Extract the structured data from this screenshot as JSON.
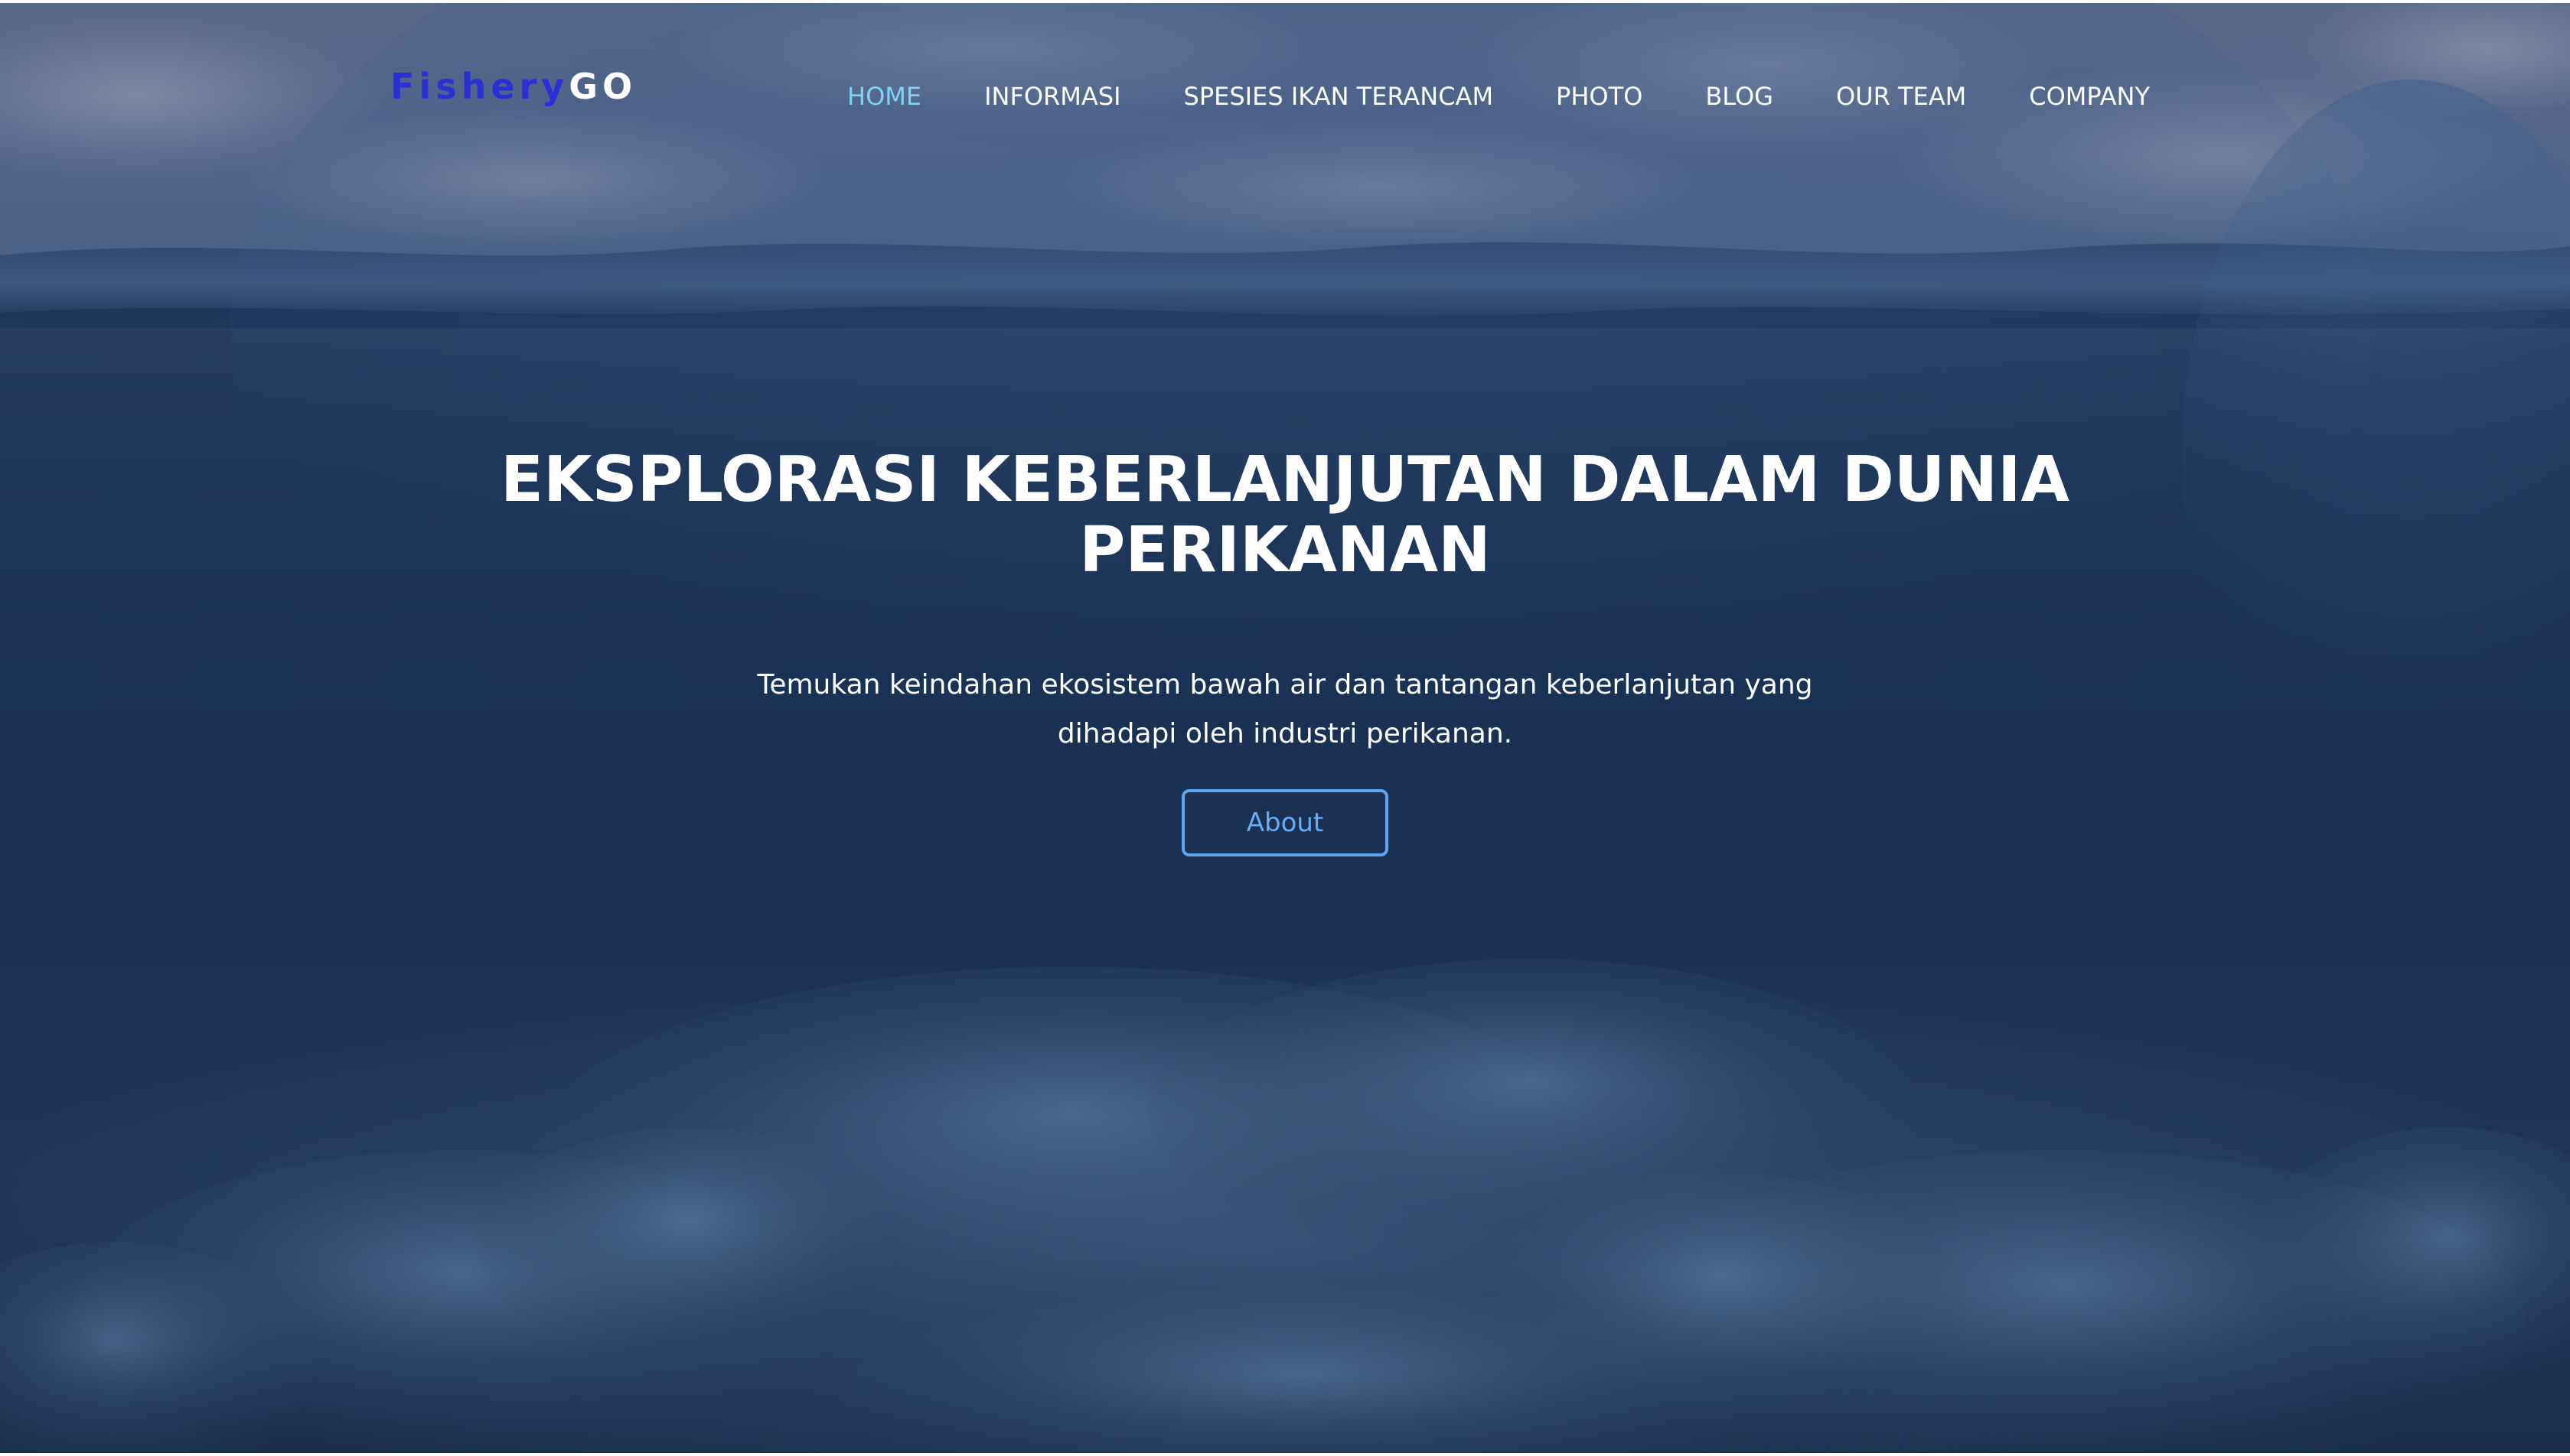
{
  "brand": {
    "part1": "Fishery",
    "part2": "GO"
  },
  "nav": {
    "items": [
      {
        "label": "HOME",
        "active": true
      },
      {
        "label": "INFORMASI",
        "active": false
      },
      {
        "label": "SPESIES IKAN TERANCAM",
        "active": false
      },
      {
        "label": "PHOTO",
        "active": false
      },
      {
        "label": "BLOG",
        "active": false
      },
      {
        "label": "OUR TEAM",
        "active": false
      },
      {
        "label": "COMPANY",
        "active": false
      }
    ]
  },
  "hero": {
    "title_line1": "EKSPLORASI KEBERLANJUTAN DALAM DUNIA",
    "title_line2": "PERIKANAN",
    "subtitle_line1": "Temukan keindahan ekosistem bawah air dan tantangan keberlanjutan yang",
    "subtitle_line2": "dihadapi oleh industri perikanan.",
    "button_label": "About"
  },
  "colors": {
    "logo_primary": "#2a2fd6",
    "nav_active": "#7fd2f5",
    "button_accent": "#5fa3ef",
    "text": "#ffffff"
  }
}
